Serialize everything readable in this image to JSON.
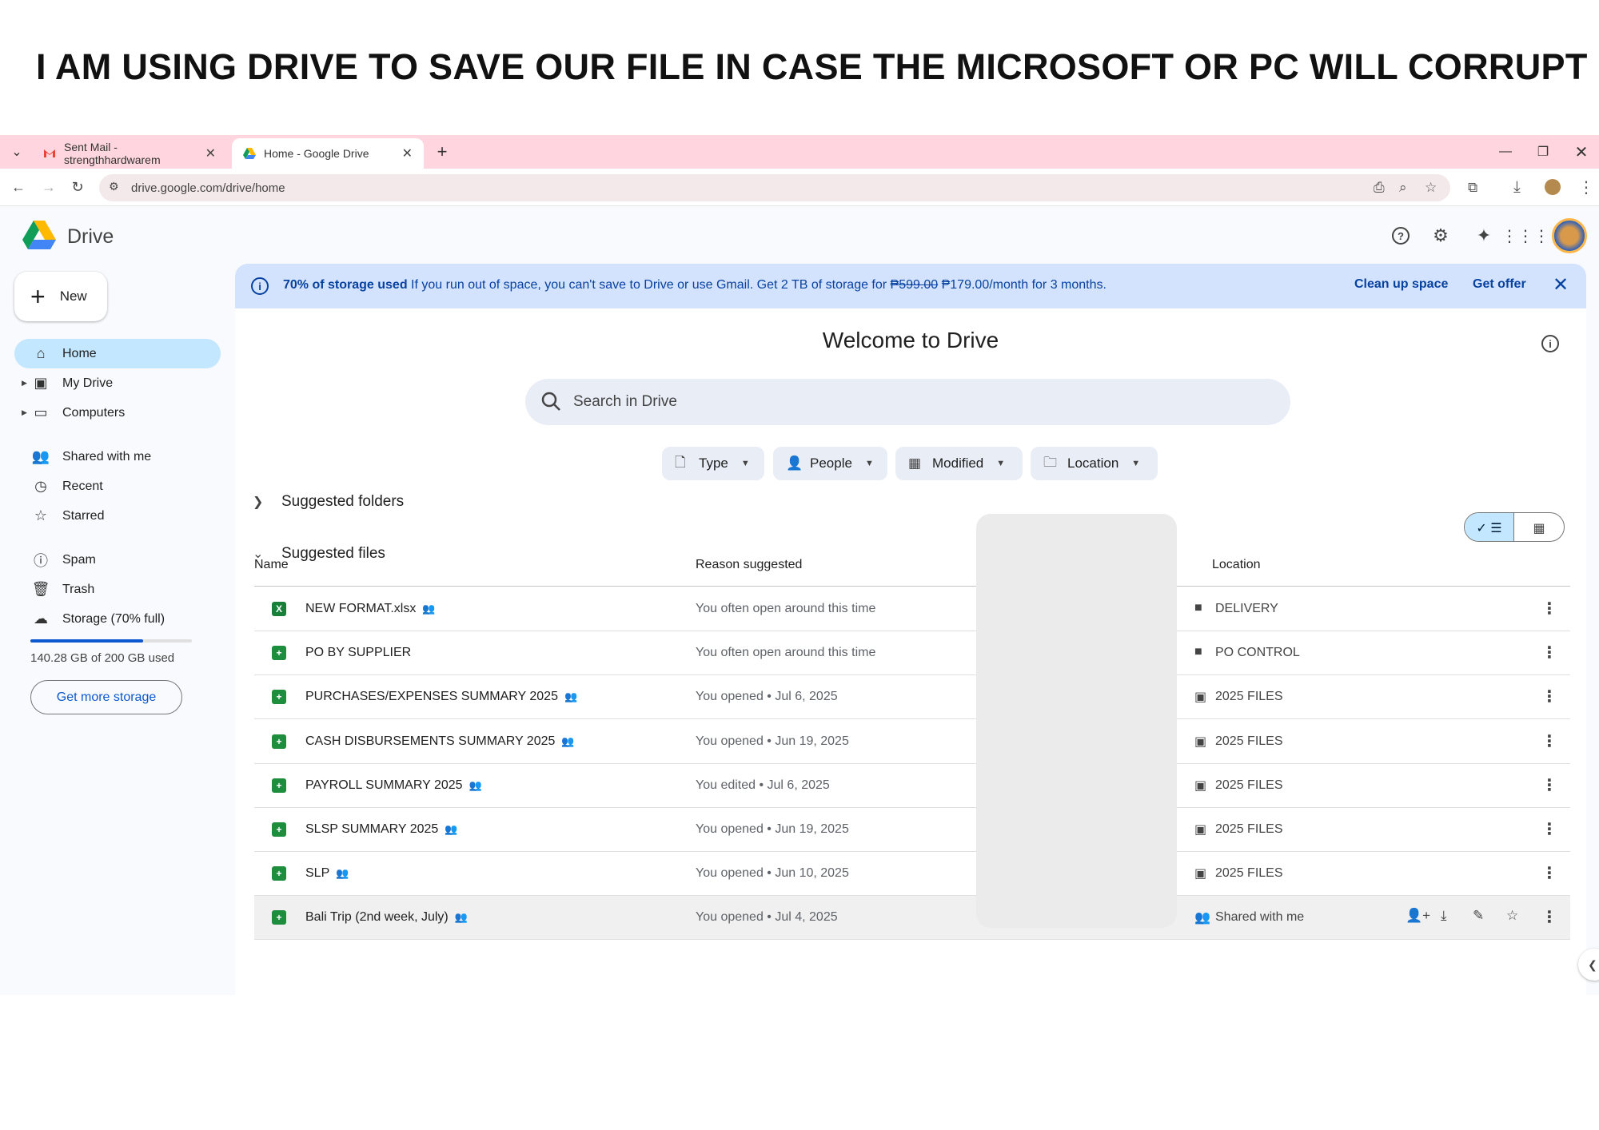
{
  "caption": "I AM  USING DRIVE TO SAVE OUR FILE IN CASE THE MICROSOFT OR PC WILL CORRUPT",
  "browser": {
    "tabs": [
      {
        "label": "Sent Mail - strengthhardwarem",
        "icon": "gmail-icon"
      },
      {
        "label": "Home - Google Drive",
        "icon": "drive-icon"
      }
    ],
    "url": "drive.google.com/drive/home"
  },
  "app": {
    "name": "Drive",
    "new_label": "New",
    "sidebar": [
      {
        "label": "Home",
        "icon": "home-icon",
        "selected": true
      },
      {
        "label": "My Drive",
        "icon": "my-drive-icon"
      },
      {
        "label": "Computers",
        "icon": "computers-icon"
      },
      {
        "label": "Shared with me",
        "icon": "shared-icon"
      },
      {
        "label": "Recent",
        "icon": "clock-icon"
      },
      {
        "label": "Starred",
        "icon": "star-icon"
      },
      {
        "label": "Spam",
        "icon": "spam-icon"
      },
      {
        "label": "Trash",
        "icon": "trash-icon"
      },
      {
        "label": "Storage (70% full)",
        "icon": "cloud-icon"
      }
    ],
    "storage": {
      "used_fraction": 0.7,
      "text": "140.28 GB of 200 GB used",
      "button": "Get more storage"
    }
  },
  "banner": {
    "bold": "70% of storage used",
    "text_before": " If you run out of space, you can't save to Drive or use Gmail. Get 2 TB of storage for ",
    "old_price": "₱599.00",
    "text_after": " ₱179.00/month for 3 months.",
    "clean_up": "Clean up space",
    "get_offer": "Get offer"
  },
  "main": {
    "welcome": "Welcome to Drive",
    "search_placeholder": "Search in Drive",
    "filters": [
      "Type",
      "People",
      "Modified",
      "Location"
    ],
    "suggested_folders": "Suggested folders",
    "suggested_files": "Suggested files",
    "columns": {
      "name": "Name",
      "reason": "Reason suggested",
      "location": "Location"
    },
    "files": [
      {
        "name": "NEW FORMAT.xlsx",
        "type": "excel",
        "shared": true,
        "reason": "You often open around this time",
        "location": "DELIVERY",
        "loc_icon": "folder"
      },
      {
        "name": "PO BY SUPPLIER",
        "type": "sheets",
        "shared": false,
        "reason": "You often open around this time",
        "location": "PO CONTROL",
        "loc_icon": "folder"
      },
      {
        "name": "PURCHASES/EXPENSES SUMMARY 2025",
        "type": "sheets",
        "shared": true,
        "reason": "You opened • Jul 6, 2025",
        "location": "2025 FILES",
        "loc_icon": "shared-folder"
      },
      {
        "name": "CASH DISBURSEMENTS SUMMARY 2025",
        "type": "sheets",
        "shared": true,
        "reason": "You opened • Jun 19, 2025",
        "location": "2025 FILES",
        "loc_icon": "shared-folder"
      },
      {
        "name": "PAYROLL SUMMARY 2025",
        "type": "sheets",
        "shared": true,
        "reason": "You edited • Jul 6, 2025",
        "location": "2025 FILES",
        "loc_icon": "shared-folder"
      },
      {
        "name": "SLSP SUMMARY 2025",
        "type": "sheets",
        "shared": true,
        "reason": "You opened • Jun 19, 2025",
        "location": "2025 FILES",
        "loc_icon": "shared-folder"
      },
      {
        "name": "SLP",
        "type": "sheets",
        "shared": true,
        "reason": "You opened • Jun 10, 2025",
        "location": "2025 FILES",
        "loc_icon": "shared-folder"
      },
      {
        "name": "Bali Trip (2nd week, July)",
        "type": "sheets",
        "shared": true,
        "reason": "You opened • Jul 4, 2025",
        "location": "Shared with me",
        "loc_icon": "people",
        "hover": true
      }
    ]
  }
}
